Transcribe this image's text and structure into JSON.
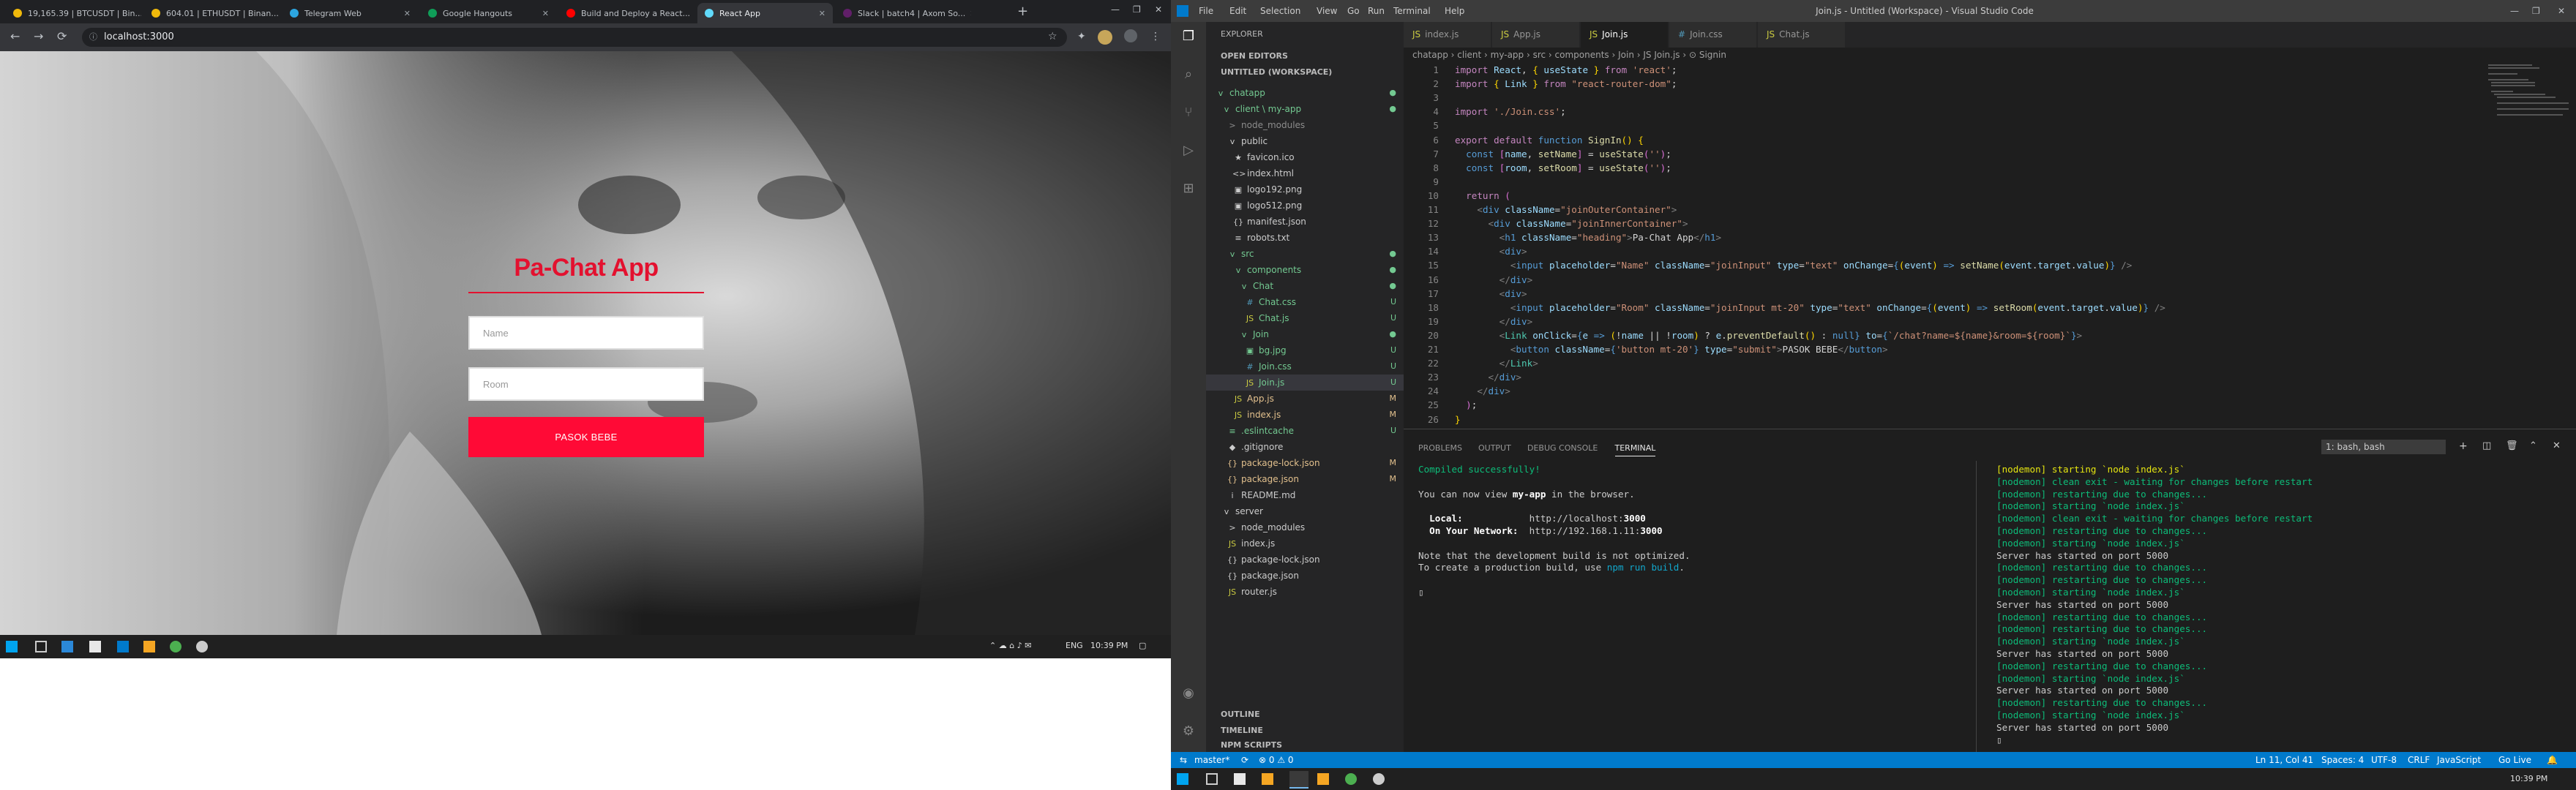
{
  "browser": {
    "tabs": [
      {
        "label": "19,165.39 | BTCUSDT | Bin...",
        "color": "#f0b90b"
      },
      {
        "label": "604.01 | ETHUSDT | Binan...",
        "color": "#f0b90b"
      },
      {
        "label": "Telegram Web",
        "color": "#2ca5e0"
      },
      {
        "label": "Google Hangouts",
        "color": "#0f9d58"
      },
      {
        "label": "Build and Deploy a React...",
        "color": "#ff0000"
      },
      {
        "label": "React App",
        "color": "#61dafb"
      },
      {
        "label": "Slack | batch4 | Axom So...",
        "color": "#611f69"
      }
    ],
    "url": "localhost:3000",
    "new_tab": "+",
    "close": "✕",
    "nav_back": "←",
    "nav_fwd": "→",
    "nav_reload": "⟳",
    "lock": "ⓘ"
  },
  "page": {
    "title": "Pa-Chat App",
    "name_placeholder": "Name",
    "room_placeholder": "Room",
    "button": "PASOK BEBE"
  },
  "win_taskbar_left": {
    "lang": "ENG",
    "time": "10:39 PM"
  },
  "vscode": {
    "title": "Join.js - Untitled (Workspace) - Visual Studio Code",
    "menu": [
      "File",
      "Edit",
      "Selection",
      "View",
      "Go",
      "Run",
      "Terminal",
      "Help"
    ],
    "explorer_title": "EXPLORER",
    "open_editors": "OPEN EDITORS",
    "workspace": "UNTITLED (WORKSPACE)",
    "tree": [
      {
        "label": "chatapp",
        "indent": 1,
        "icon": "v",
        "badge": "●",
        "type": "folder",
        "color": "#73c991"
      },
      {
        "label": "client \\ my-app",
        "indent": 2,
        "icon": "v",
        "badge": "●",
        "type": "folder",
        "color": "#73c991"
      },
      {
        "label": "node_modules",
        "indent": 3,
        "icon": ">",
        "badge": "",
        "type": "folder",
        "color": "#8c8c8c"
      },
      {
        "label": "public",
        "indent": 3,
        "icon": "v",
        "badge": "",
        "type": "folder",
        "color": "#ccc"
      },
      {
        "label": "favicon.ico",
        "indent": 4,
        "icon": "★",
        "badge": "",
        "type": "file",
        "color": "#ccc"
      },
      {
        "label": "index.html",
        "indent": 4,
        "icon": "<>",
        "badge": "",
        "type": "file",
        "color": "#ccc"
      },
      {
        "label": "logo192.png",
        "indent": 4,
        "icon": "▣",
        "badge": "",
        "type": "file",
        "color": "#ccc"
      },
      {
        "label": "logo512.png",
        "indent": 4,
        "icon": "▣",
        "badge": "",
        "type": "file",
        "color": "#ccc"
      },
      {
        "label": "manifest.json",
        "indent": 4,
        "icon": "{}",
        "badge": "",
        "type": "file",
        "color": "#ccc"
      },
      {
        "label": "robots.txt",
        "indent": 4,
        "icon": "≡",
        "badge": "",
        "type": "file",
        "color": "#ccc"
      },
      {
        "label": "src",
        "indent": 3,
        "icon": "v",
        "badge": "●",
        "type": "folder",
        "color": "#73c991"
      },
      {
        "label": "components",
        "indent": 4,
        "icon": "v",
        "badge": "●",
        "type": "folder",
        "color": "#73c991"
      },
      {
        "label": "Chat",
        "indent": 5,
        "icon": "v",
        "badge": "●",
        "type": "folder",
        "color": "#73c991"
      },
      {
        "label": "Chat.css",
        "indent": 6,
        "icon": "#",
        "badge": "U",
        "type": "file",
        "color": "#73c991"
      },
      {
        "label": "Chat.js",
        "indent": 6,
        "icon": "JS",
        "badge": "U",
        "type": "file",
        "color": "#73c991"
      },
      {
        "label": "Join",
        "indent": 5,
        "icon": "v",
        "badge": "●",
        "type": "folder",
        "color": "#73c991"
      },
      {
        "label": "bg.jpg",
        "indent": 6,
        "icon": "▣",
        "badge": "U",
        "type": "file",
        "color": "#73c991"
      },
      {
        "label": "Join.css",
        "indent": 6,
        "icon": "#",
        "badge": "U",
        "type": "file",
        "color": "#73c991"
      },
      {
        "label": "Join.js",
        "indent": 6,
        "icon": "JS",
        "badge": "U",
        "type": "file",
        "color": "#73c991"
      },
      {
        "label": "App.js",
        "indent": 4,
        "icon": "JS",
        "badge": "M",
        "type": "file",
        "color": "#e2c08d"
      },
      {
        "label": "index.js",
        "indent": 4,
        "icon": "JS",
        "badge": "M",
        "type": "file",
        "color": "#e2c08d"
      },
      {
        "label": ".eslintcache",
        "indent": 3,
        "icon": "≡",
        "badge": "U",
        "type": "file",
        "color": "#73c991"
      },
      {
        "label": ".gitignore",
        "indent": 3,
        "icon": "◆",
        "badge": "",
        "type": "file",
        "color": "#ccc"
      },
      {
        "label": "package-lock.json",
        "indent": 3,
        "icon": "{}",
        "badge": "M",
        "type": "file",
        "color": "#e2c08d"
      },
      {
        "label": "package.json",
        "indent": 3,
        "icon": "{}",
        "badge": "M",
        "type": "file",
        "color": "#e2c08d"
      },
      {
        "label": "README.md",
        "indent": 3,
        "icon": "i",
        "badge": "",
        "type": "file",
        "color": "#ccc"
      },
      {
        "label": "server",
        "indent": 2,
        "icon": "v",
        "badge": "",
        "type": "folder",
        "color": "#ccc"
      },
      {
        "label": "node_modules",
        "indent": 3,
        "icon": ">",
        "badge": "",
        "type": "folder",
        "color": "#ccc"
      },
      {
        "label": "index.js",
        "indent": 3,
        "icon": "JS",
        "badge": "",
        "type": "file",
        "color": "#ccc"
      },
      {
        "label": "package-lock.json",
        "indent": 3,
        "icon": "{}",
        "badge": "",
        "type": "file",
        "color": "#ccc"
      },
      {
        "label": "package.json",
        "indent": 3,
        "icon": "{}",
        "badge": "",
        "type": "file",
        "color": "#ccc"
      },
      {
        "label": "router.js",
        "indent": 3,
        "icon": "JS",
        "badge": "",
        "type": "file",
        "color": "#ccc"
      }
    ],
    "outline": "OUTLINE",
    "timeline": "TIMELINE",
    "npm": "NPM SCRIPTS",
    "editor_tabs": [
      {
        "label": "index.js",
        "kind": "js"
      },
      {
        "label": "App.js",
        "kind": "js"
      },
      {
        "label": "Join.js",
        "kind": "js",
        "active": true
      },
      {
        "label": "Join.css",
        "kind": "css"
      },
      {
        "label": "Chat.js",
        "kind": "js"
      }
    ],
    "breadcrumb": "chatapp › client › my-app › src › components › Join › JS Join.js › ⊙ Signin",
    "code": [
      "<span class='kc'>import</span> <span class='v'>React</span>, <span class='b'>{</span> <span class='v'>useState</span> <span class='b'>}</span> <span class='kc'>from</span> <span class='s'>'react'</span>;",
      "<span class='kc'>import</span> <span class='b'>{</span> <span class='v'>Link</span> <span class='b'>}</span> <span class='kc'>from</span> <span class='s'>\"react-router-dom\"</span>;",
      "",
      "<span class='kc'>import</span> <span class='s'>'./Join.css'</span>;",
      "",
      "<span class='kc'>export</span> <span class='kc'>default</span> <span class='k'>function</span> <span class='f'>SignIn</span><span class='b'>()</span> <span class='b'>{</span>",
      "  <span class='k'>const</span> <span class='c'>[</span><span class='v'>name</span>, <span class='f'>setName</span><span class='c'>]</span> = <span class='f'>useState</span><span class='c'>(</span><span class='s'>''</span><span class='c'>)</span>;",
      "  <span class='k'>const</span> <span class='c'>[</span><span class='v'>room</span>, <span class='f'>setRoom</span><span class='c'>]</span> = <span class='f'>useState</span><span class='c'>(</span><span class='s'>''</span><span class='c'>)</span>;",
      "",
      "  <span class='kc'>return</span> <span class='c'>(</span>",
      "    <span class='p'>&lt;</span><span class='k'>div</span> <span class='v'>className</span>=<span class='s'>\"joinOuterContainer\"</span><span class='p'>&gt;</span>",
      "      <span class='p'>&lt;</span><span class='k'>div</span> <span class='v'>className</span>=<span class='s'>\"joinInnerContainer\"</span><span class='p'>&gt;</span>",
      "        <span class='p'>&lt;</span><span class='k'>h1</span> <span class='v'>className</span>=<span class='s'>\"heading\"</span><span class='p'>&gt;</span>Pa-Chat App<span class='p'>&lt;/</span><span class='k'>h1</span><span class='p'>&gt;</span>",
      "        <span class='p'>&lt;</span><span class='k'>div</span><span class='p'>&gt;</span>",
      "          <span class='p'>&lt;</span><span class='k'>input</span> <span class='v'>placeholder</span>=<span class='s'>\"Name\"</span> <span class='v'>className</span>=<span class='s'>\"joinInput\"</span> <span class='v'>type</span>=<span class='s'>\"text\"</span> <span class='v'>onChange</span>=<span class='k'>{</span><span class='b'>(</span><span class='v'>event</span><span class='b'>)</span> <span class='k'>=&gt;</span> <span class='f'>setName</span><span class='b'>(</span><span class='v'>event</span>.<span class='v'>target</span>.<span class='v'>value</span><span class='b'>)</span><span class='k'>}</span> <span class='p'>/&gt;</span>",
      "        <span class='p'>&lt;/</span><span class='k'>div</span><span class='p'>&gt;</span>",
      "        <span class='p'>&lt;</span><span class='k'>div</span><span class='p'>&gt;</span>",
      "          <span class='p'>&lt;</span><span class='k'>input</span> <span class='v'>placeholder</span>=<span class='s'>\"Room\"</span> <span class='v'>className</span>=<span class='s'>\"joinInput mt-20\"</span> <span class='v'>type</span>=<span class='s'>\"text\"</span> <span class='v'>onChange</span>=<span class='k'>{</span><span class='b'>(</span><span class='v'>event</span><span class='b'>)</span> <span class='k'>=&gt;</span> <span class='f'>setRoom</span><span class='b'>(</span><span class='v'>event</span>.<span class='v'>target</span>.<span class='v'>value</span><span class='b'>)</span><span class='k'>}</span> <span class='p'>/&gt;</span>",
      "        <span class='p'>&lt;/</span><span class='k'>div</span><span class='p'>&gt;</span>",
      "        <span class='p'>&lt;</span><span class='t'>Link</span> <span class='v'>onClick</span>=<span class='k'>{</span><span class='v'>e</span> <span class='k'>=&gt;</span> <span class='b'>(</span>!<span class='v'>name</span> || !<span class='v'>room</span><span class='b'>)</span> ? <span class='v'>e</span>.<span class='f'>preventDefault</span><span class='b'>()</span> : <span class='k'>null</span><span class='k'>}</span> <span class='v'>to</span>=<span class='k'>{</span><span class='s'>`/chat?name=${name}&amp;room=${room}`</span><span class='k'>}</span><span class='p'>&gt;</span>",
      "          <span class='p'>&lt;</span><span class='k'>button</span> <span class='v'>className</span>=<span class='k'>{</span><span class='s'>'button mt-20'</span><span class='k'>}</span> <span class='v'>type</span>=<span class='s'>\"submit\"</span><span class='p'>&gt;</span>PASOK BEBE<span class='p'>&lt;/</span><span class='k'>button</span><span class='p'>&gt;</span>",
      "        <span class='p'>&lt;/</span><span class='t'>Link</span><span class='p'>&gt;</span>",
      "      <span class='p'>&lt;/</span><span class='k'>div</span><span class='p'>&gt;</span>",
      "    <span class='p'>&lt;/</span><span class='k'>div</span><span class='p'>&gt;</span>",
      "  <span class='c'>)</span>;",
      "<span class='b'>}</span>"
    ],
    "panel_tabs": [
      "PROBLEMS",
      "OUTPUT",
      "DEBUG CONSOLE",
      "TERMINAL"
    ],
    "terminal_select": "1: bash, bash",
    "term_left": [
      "<span class='green'>Compiled successfully!</span>",
      "",
      "You can now view <span class='wb'>my-app</span> in the browser.",
      "",
      "  <span class='wb'>Local:</span>            http://localhost:<span class='wb'>3000</span>",
      "  <span class='wb'>On Your Network:</span>  http://192.168.1.11:<span class='wb'>3000</span>",
      "",
      "Note that the development build is not optimized.",
      "To create a production build, use <span class='cy'>npm run build</span>.",
      "",
      "▯"
    ],
    "term_right": [
      "<span class='yel'>[nodemon] starting `node index.js`</span>",
      "<span class='green'>[nodemon] clean exit - waiting for changes before restart</span>",
      "<span class='green'>[nodemon] restarting due to changes...</span>",
      "<span class='green'>[nodemon] starting `node index.js`</span>",
      "<span class='green'>[nodemon] clean exit - waiting for changes before restart</span>",
      "<span class='green'>[nodemon] restarting due to changes...</span>",
      "<span class='green'>[nodemon] starting `node index.js`</span>",
      "Server has started on port 5000",
      "<span class='green'>[nodemon] restarting due to changes...</span>",
      "<span class='green'>[nodemon] restarting due to changes...</span>",
      "<span class='green'>[nodemon] starting `node index.js`</span>",
      "Server has started on port 5000",
      "<span class='green'>[nodemon] restarting due to changes...</span>",
      "<span class='green'>[nodemon] restarting due to changes...</span>",
      "<span class='green'>[nodemon] starting `node index.js`</span>",
      "Server has started on port 5000",
      "<span class='green'>[nodemon] restarting due to changes...</span>",
      "<span class='green'>[nodemon] starting `node index.js`</span>",
      "Server has started on port 5000",
      "<span class='green'>[nodemon] restarting due to changes...</span>",
      "<span class='green'>[nodemon] starting `node index.js`</span>",
      "Server has started on port 5000",
      "▯"
    ],
    "status": {
      "branch": "master*",
      "sync": "⟳",
      "problems": "⊗ 0 ⚠ 0",
      "position": "Ln 11, Col 41",
      "spaces": "Spaces: 4",
      "encoding": "UTF-8",
      "eol": "CRLF",
      "lang": "JavaScript",
      "golive": "Go Live"
    },
    "taskbar_time": "10:39 PM"
  }
}
